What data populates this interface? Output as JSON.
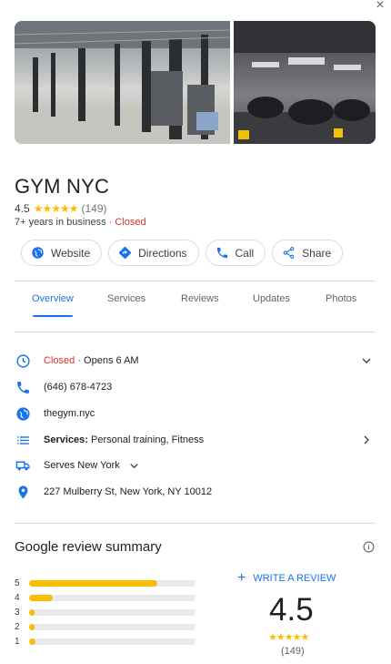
{
  "place": {
    "name": "GYM NYC",
    "rating": "4.5",
    "stars": "★★★★★",
    "review_count": "(149)",
    "years": "7+ years in business",
    "separator": "·",
    "status": "Closed"
  },
  "actions": [
    {
      "label": "Website",
      "icon": "globe-icon"
    },
    {
      "label": "Directions",
      "icon": "directions-icon"
    },
    {
      "label": "Call",
      "icon": "phone-icon"
    },
    {
      "label": "Share",
      "icon": "share-icon"
    }
  ],
  "tabs": [
    {
      "label": "Overview",
      "active": true
    },
    {
      "label": "Services"
    },
    {
      "label": "Reviews"
    },
    {
      "label": "Updates"
    },
    {
      "label": "Photos"
    }
  ],
  "details": {
    "hours_status": "Closed",
    "hours_sep": " · ",
    "hours_next": "Opens 6 AM",
    "phone": "(646) 678-4723",
    "website": "thegym.nyc",
    "services_label": "Services:",
    "services_value": "Personal training, Fitness",
    "serves": "Serves New York",
    "address": "227 Mulberry St, New York, NY 10012"
  },
  "review_summary": {
    "title": "Google review summary",
    "write_review": "WRITE A REVIEW",
    "rating": "4.5",
    "stars": "★★★★★",
    "count": "(149)",
    "distribution": [
      {
        "label": "5",
        "fraction": 0.77
      },
      {
        "label": "4",
        "fraction": 0.14
      },
      {
        "label": "3",
        "fraction": 0.03
      },
      {
        "label": "2",
        "fraction": 0.02
      },
      {
        "label": "1",
        "fraction": 0.04
      }
    ]
  },
  "colors": {
    "accent": "#1a73e8",
    "closed": "#d93025",
    "star": "#fbbc04"
  }
}
